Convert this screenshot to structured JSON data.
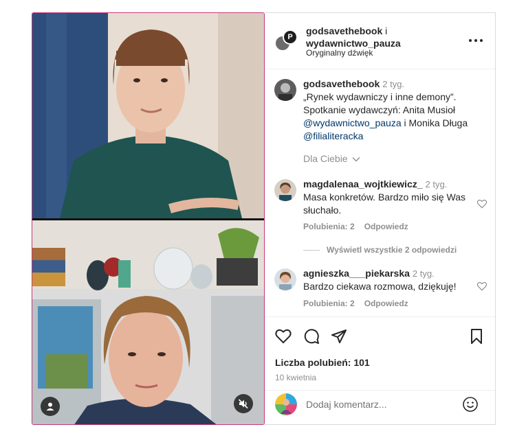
{
  "header": {
    "user1": "godsavethebook",
    "connector": " i",
    "user2": "wydawnictwo_pauza",
    "audio": "Oryginalny dźwięk"
  },
  "caption": {
    "username": "godsavethebook",
    "time": "2 tyg.",
    "text1": "„Rynek wydawniczy i inne demony”. Spotkanie wydawczyń: Anita Musioł ",
    "mention1": "@wydawnictwo_pauza",
    "text2": " i Monika Długa ",
    "mention2": "@filialiteracka",
    "for_you": "Dla Ciebie"
  },
  "comments": [
    {
      "username": "magdalenaa_wojtkiewicz_",
      "time": "2 tyg.",
      "text": "Masa konkretów. Bardzo miło się Was słuchało.",
      "likes": "Polubienia: 2",
      "reply": "Odpowiedz",
      "view_replies": "Wyświetl wszystkie 2 odpowiedzi"
    },
    {
      "username": "agnieszka___piekarska",
      "time": "2 tyg.",
      "text": "Bardzo ciekawa rozmowa, dziękuję!",
      "likes": "Polubienia: 2",
      "reply": "Odpowiedz"
    }
  ],
  "actions": {
    "likes_count": "Liczba polubień: 101",
    "date": "10 kwietnia",
    "like_icon": "heart-icon",
    "comment_icon": "comment-bubble-icon",
    "share_icon": "paper-plane-icon",
    "save_icon": "bookmark-icon"
  },
  "add_comment": {
    "placeholder": "Dodaj komentarz..."
  },
  "colors": {
    "video_border": "#c9367a",
    "mention": "#00376b",
    "muted_text": "#8e8e8e"
  }
}
